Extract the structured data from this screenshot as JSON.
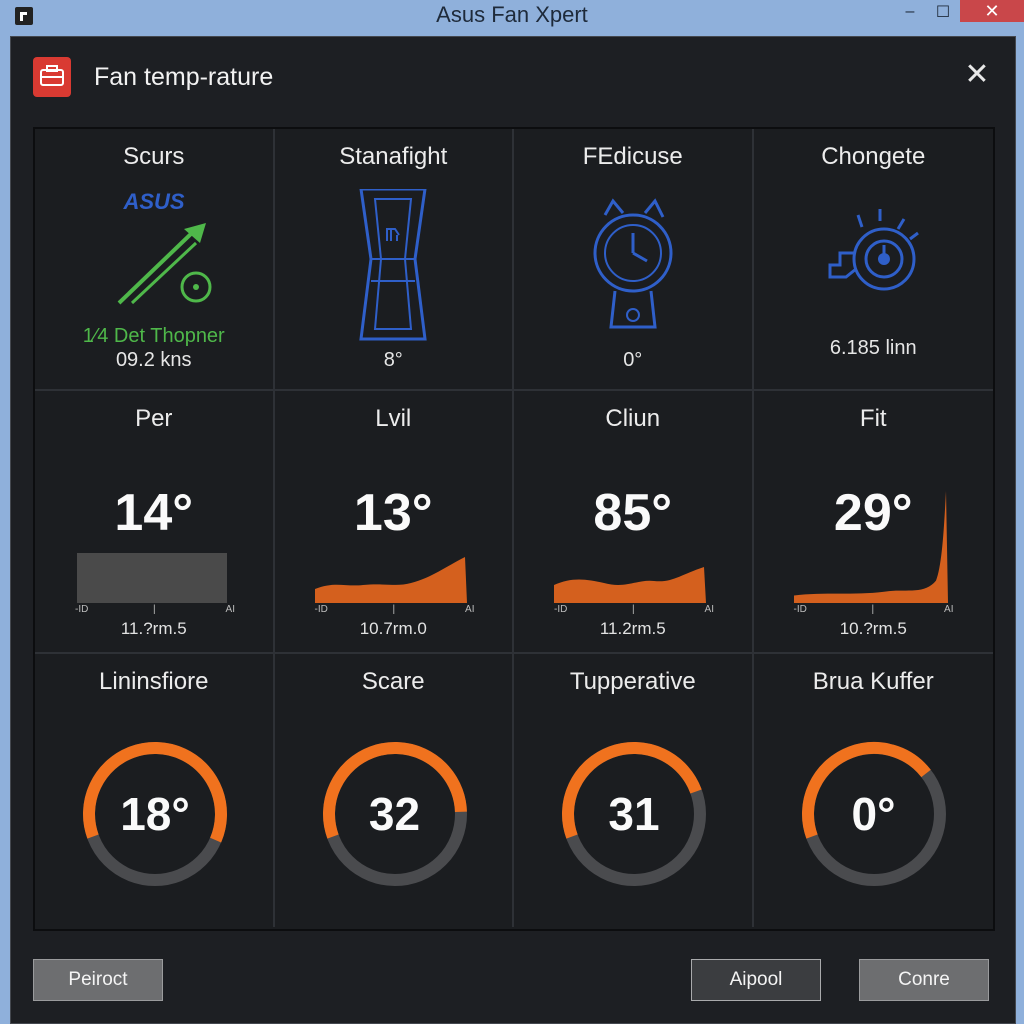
{
  "window": {
    "title": "Asus Fan Xpert",
    "min_glyph": "–",
    "max_glyph": "☐",
    "close_glyph": "✕"
  },
  "dialog": {
    "title": "Fan temp-rature",
    "close_glyph": "✕"
  },
  "tiles": [
    {
      "label": "Scurs",
      "icon": "asus-logo-fan-icon",
      "icon_text": "ASUS",
      "sub1": "1⁄4 Det Thopner",
      "sub2": "09.2 kns"
    },
    {
      "label": "Stanafight",
      "icon": "fan-duct-icon",
      "sub1": "8°"
    },
    {
      "label": "FEdicuse",
      "icon": "clock-tower-icon",
      "sub1": "0°"
    },
    {
      "label": "Chongete",
      "icon": "fan-gauge-icon",
      "sub1": "6.185 linn"
    },
    {
      "label": "Per",
      "value": "14°",
      "axis_left": "-ID",
      "axis_mid": "|",
      "axis_right": "AI",
      "caption": "11.?rm.5",
      "graph": "flat-bar"
    },
    {
      "label": "Lvil",
      "value": "13°",
      "axis_left": "-ID",
      "axis_mid": "|",
      "axis_right": "AI",
      "caption": "10.7rm.0",
      "graph": "rising"
    },
    {
      "label": "Cliun",
      "value": "85°",
      "axis_left": "-ID",
      "axis_mid": "|",
      "axis_right": "AI",
      "caption": "11.2rm.5",
      "graph": "wavy"
    },
    {
      "label": "Fit",
      "value": "29°",
      "axis_left": "-ID",
      "axis_mid": "|",
      "axis_right": "AI",
      "caption": "10.?rm.5",
      "graph": "spike"
    },
    {
      "label": "Lininsfiore",
      "value": "18°",
      "gauge_fraction": 0.62
    },
    {
      "label": "Scare",
      "value": "32",
      "gauge_fraction": 0.55
    },
    {
      "label": "Tupperative",
      "value": "31",
      "gauge_fraction": 0.5
    },
    {
      "label": "Brua Kuffer",
      "value": "0°",
      "gauge_fraction": 0.45
    }
  ],
  "buttons": {
    "left": "Peiroct",
    "apply": "Aipool",
    "right": "Conre"
  },
  "colors": {
    "accent_orange": "#f0721e",
    "graph_orange": "#d4601e",
    "gauge_track": "#4a4b4e",
    "green": "#4fb84a",
    "blue": "#2f5fc9",
    "dialog_bg": "#1d1f23"
  }
}
